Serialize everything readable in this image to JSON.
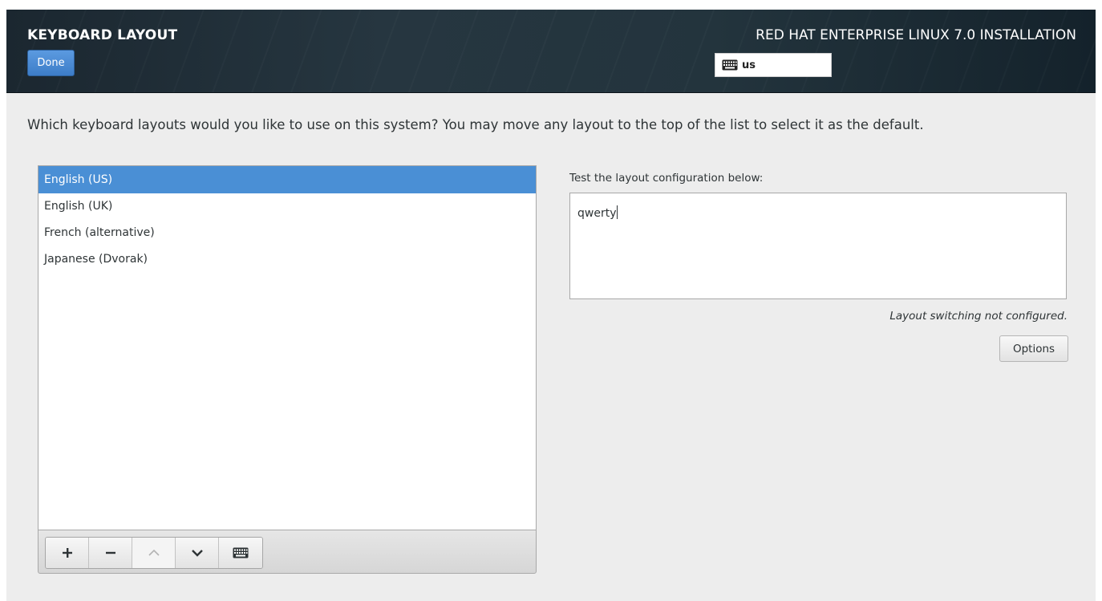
{
  "header": {
    "spoke_title": "KEYBOARD LAYOUT",
    "done_label": "Done",
    "product_title": "RED HAT ENTERPRISE LINUX 7.0 INSTALLATION",
    "keyboard_indicator": {
      "icon": "keyboard-icon",
      "value": "us"
    }
  },
  "prompt": "Which keyboard layouts would you like to use on this system?  You may move any layout to the top of the list to select it as the default.",
  "layouts": {
    "items": [
      {
        "label": "English (US)",
        "selected": true
      },
      {
        "label": "English (UK)",
        "selected": false
      },
      {
        "label": "French (alternative)",
        "selected": false
      },
      {
        "label": "Japanese (Dvorak)",
        "selected": false
      }
    ],
    "toolbar": {
      "add": "+",
      "remove": "−",
      "move_up": "^",
      "move_down": "v",
      "preview_icon": "keyboard-icon"
    }
  },
  "test": {
    "label": "Test the layout configuration below:",
    "value": "qwerty"
  },
  "switching_note": "Layout switching not configured.",
  "options_label": "Options",
  "colors": {
    "accent": "#4a8fd5",
    "header_bg": "#1f2d36",
    "page_bg": "#ededed"
  }
}
